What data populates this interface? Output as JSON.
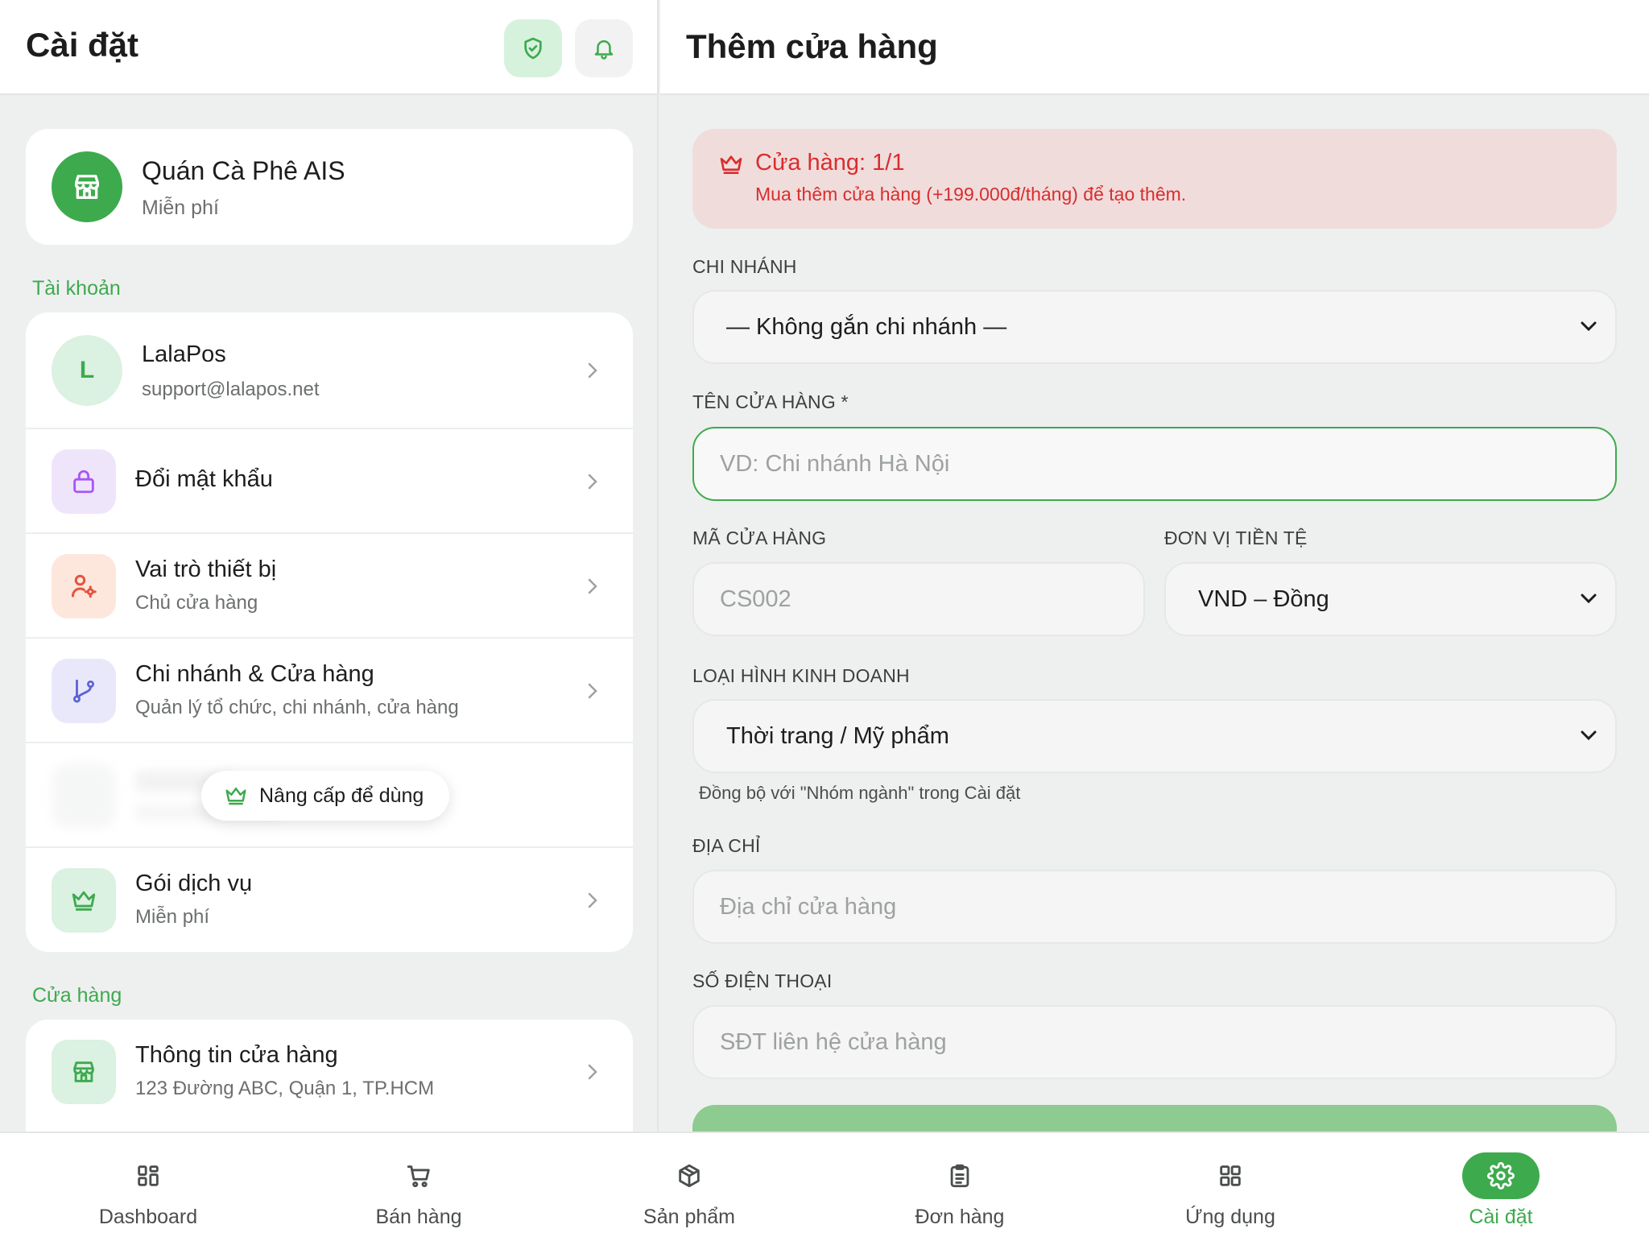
{
  "left": {
    "title": "Cài đặt",
    "store": {
      "name": "Quán Cà Phê AIS",
      "plan": "Miễn phí"
    },
    "section_account": "Tài khoản",
    "user": {
      "initial": "L",
      "name": "LalaPos",
      "email": "support@lalapos.net"
    },
    "items": [
      {
        "title": "Đổi mật khẩu"
      },
      {
        "title": "Vai trò thiết bị",
        "subtitle": "Chủ cửa hàng"
      },
      {
        "title": "Chi nhánh & Cửa hàng",
        "subtitle": "Quản lý tổ chức, chi nhánh, cửa hàng"
      },
      {
        "title": "Gói dịch vụ",
        "subtitle": "Miễn phí"
      }
    ],
    "upgrade_label": "Nâng cấp để dùng",
    "section_store": "Cửa hàng",
    "store_info": {
      "title": "Thông tin cửa hàng",
      "subtitle": "123 Đường ABC, Quận 1, TP.HCM"
    }
  },
  "right": {
    "title": "Thêm cửa hàng",
    "quota": {
      "title": "Cửa hàng: 1/1",
      "description": "Mua thêm cửa hàng (+199.000đ/tháng) để tạo thêm."
    },
    "branch": {
      "label": "CHI NHÁNH",
      "value": "— Không gắn chi nhánh —"
    },
    "name": {
      "label": "TÊN CỬA HÀNG *",
      "placeholder": "VD: Chi nhánh Hà Nội"
    },
    "code": {
      "label": "MÃ CỬA HÀNG",
      "placeholder": "CS002"
    },
    "currency": {
      "label": "ĐƠN VỊ TIỀN TỆ",
      "value": "VND – Đồng"
    },
    "business_type": {
      "label": "LOẠI HÌNH KINH DOANH",
      "value": "Thời trang / Mỹ phẩm",
      "hint": "Đồng bộ với \"Nhóm ngành\" trong Cài đặt"
    },
    "address": {
      "label": "ĐỊA CHỈ",
      "placeholder": "Địa chỉ cửa hàng"
    },
    "phone": {
      "label": "SỐ ĐIỆN THOẠI",
      "placeholder": "SĐT liên hệ cửa hàng"
    }
  },
  "nav": [
    {
      "label": "Dashboard",
      "icon": "grid-icon"
    },
    {
      "label": "Bán hàng",
      "icon": "cart-icon"
    },
    {
      "label": "Sản phẩm",
      "icon": "box-icon"
    },
    {
      "label": "Đơn hàng",
      "icon": "clipboard-icon"
    },
    {
      "label": "Ứng dụng",
      "icon": "apps-icon"
    },
    {
      "label": "Cài đặt",
      "icon": "gear-icon",
      "active": true
    }
  ],
  "colors": {
    "accent": "#3daa4e",
    "danger": "#d92d2d",
    "danger_bg": "#f1dcdc"
  }
}
